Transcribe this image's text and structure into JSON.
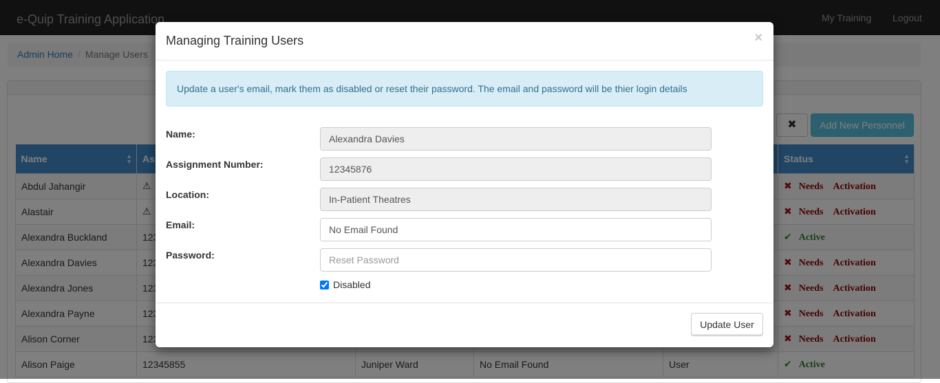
{
  "navbar": {
    "brand": "e-Quip Training Application",
    "my_training": "My Training",
    "logout": "Logout"
  },
  "breadcrumb": {
    "home": "Admin Home",
    "current": "Manage Users"
  },
  "toolbar": {
    "clear_symbol": "✖",
    "add_personnel": "Add New Personnel"
  },
  "table": {
    "columns": {
      "name": "Name",
      "assignment": "As",
      "status": "Status"
    },
    "rows": [
      {
        "name": "Abdul Jahangir",
        "assignment": "⚠",
        "location": "",
        "email": "",
        "role": "",
        "status_kind": "needs",
        "status_word1": "Needs",
        "status_word2": "Activation"
      },
      {
        "name": "Alastair",
        "assignment": "⚠",
        "location": "",
        "email": "",
        "role": "",
        "status_kind": "needs",
        "status_word1": "Needs",
        "status_word2": "Activation"
      },
      {
        "name": "Alexandra Buckland",
        "assignment": "123",
        "location": "",
        "email": "",
        "role": "",
        "status_kind": "active",
        "status_word1": "Active",
        "status_word2": ""
      },
      {
        "name": "Alexandra Davies",
        "assignment": "123",
        "location": "",
        "email": "",
        "role": "",
        "status_kind": "needs",
        "status_word1": "Needs",
        "status_word2": "Activation"
      },
      {
        "name": "Alexandra Jones",
        "assignment": "123",
        "location": "",
        "email": "",
        "role": "",
        "status_kind": "needs",
        "status_word1": "Needs",
        "status_word2": "Activation"
      },
      {
        "name": "Alexandra Payne",
        "assignment": "123",
        "location": "",
        "email": "",
        "role": "",
        "status_kind": "needs",
        "status_word1": "Needs",
        "status_word2": "Activation"
      },
      {
        "name": "Alison Corner",
        "assignment": "123",
        "location": "",
        "email": "",
        "role": "",
        "status_kind": "needs",
        "status_word1": "Needs",
        "status_word2": "Activation"
      },
      {
        "name": "Alison Paige",
        "assignment": "12345855",
        "location": "Juniper Ward",
        "email": "No Email Found",
        "role": "User",
        "status_kind": "active",
        "status_word1": "Active",
        "status_word2": ""
      }
    ]
  },
  "modal": {
    "title": "Managing Training Users",
    "close_symbol": "×",
    "info": "Update a user's email, mark them as disabled or reset their password. The email and password will be thier login details",
    "labels": {
      "name": "Name:",
      "assignment": "Assignment Number:",
      "location": "Location:",
      "email": "Email:",
      "password": "Password:"
    },
    "values": {
      "name": "Alexandra Davies",
      "assignment": "12345876",
      "location": "In-Patient Theatres",
      "email": "No Email Found"
    },
    "password_placeholder": "Reset Password",
    "disabled_label": "Disabled",
    "disabled_checked": true,
    "update_button": "Update User"
  },
  "colors": {
    "navbar": "#222222",
    "table_header": "#428bca",
    "info_bg": "#d9edf7",
    "add_button": "#5bc0de",
    "needs_activation": "#8b0000",
    "active": "#2e7d2e"
  }
}
